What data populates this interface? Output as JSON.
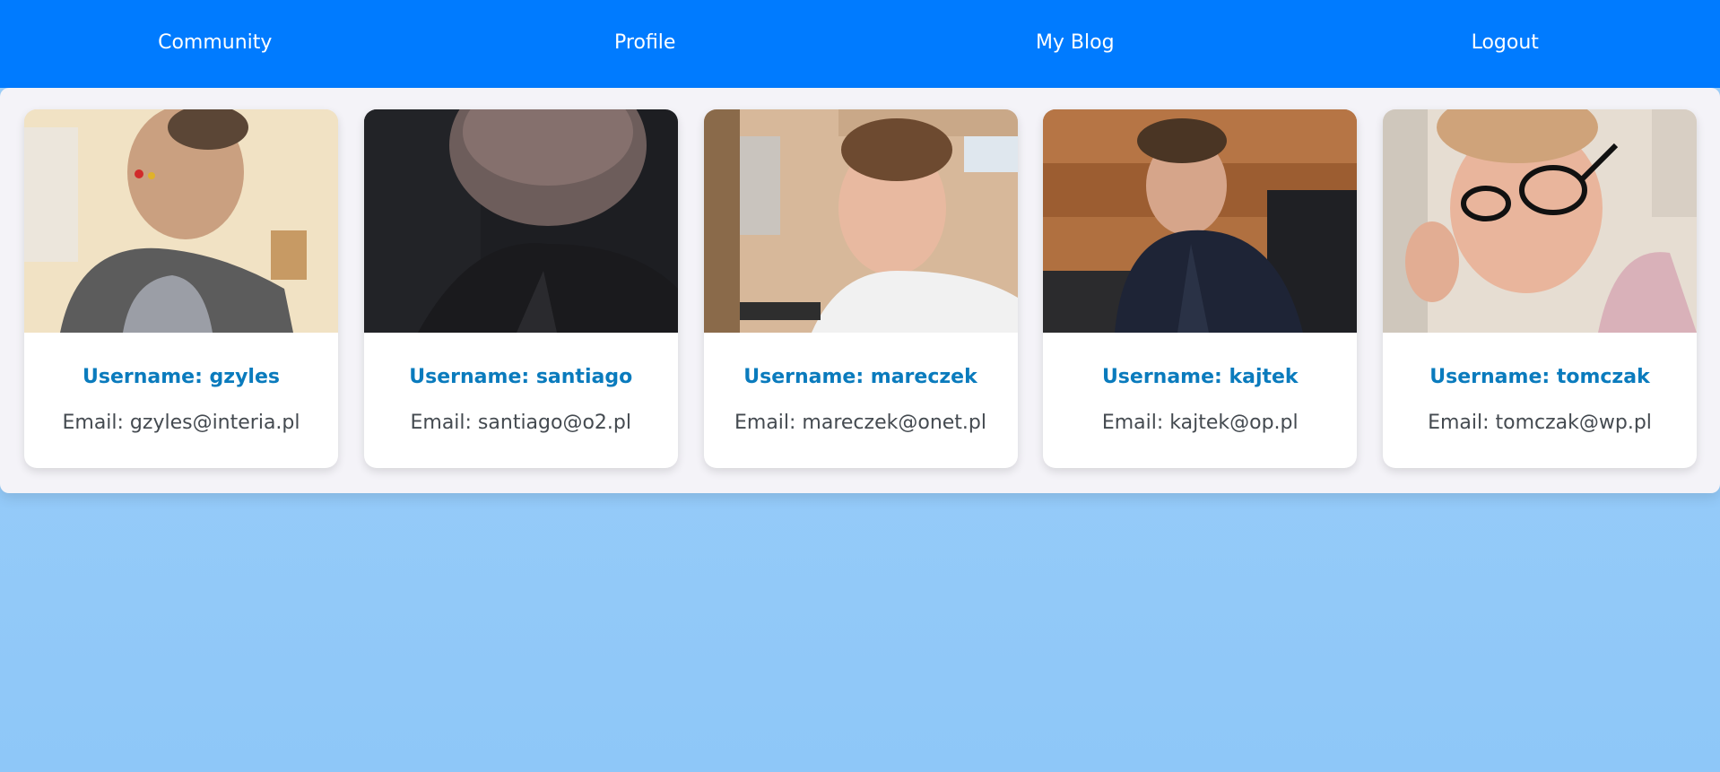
{
  "nav": {
    "items": [
      {
        "label": "Community"
      },
      {
        "label": "Profile"
      },
      {
        "label": "My Blog"
      },
      {
        "label": "Logout"
      }
    ],
    "color": "#007bff"
  },
  "users": [
    {
      "username": "Username: gzyles",
      "email": "Email: gzyles@interia.pl",
      "photo": "user-photo"
    },
    {
      "username": "Username: santiago",
      "email": "Email: santiago@o2.pl",
      "photo": "user-photo"
    },
    {
      "username": "Username: mareczek",
      "email": "Email: mareczek@onet.pl",
      "photo": "user-photo"
    },
    {
      "username": "Username: kajtek",
      "email": "Email: kajtek@op.pl",
      "photo": "user-photo"
    },
    {
      "username": "Username: tomczak",
      "email": "Email: tomczak@wp.pl",
      "photo": "user-photo"
    }
  ],
  "colors": {
    "username": "#0a7bbd",
    "background": "#9fd0fa",
    "panel": "#f4f3f8"
  }
}
